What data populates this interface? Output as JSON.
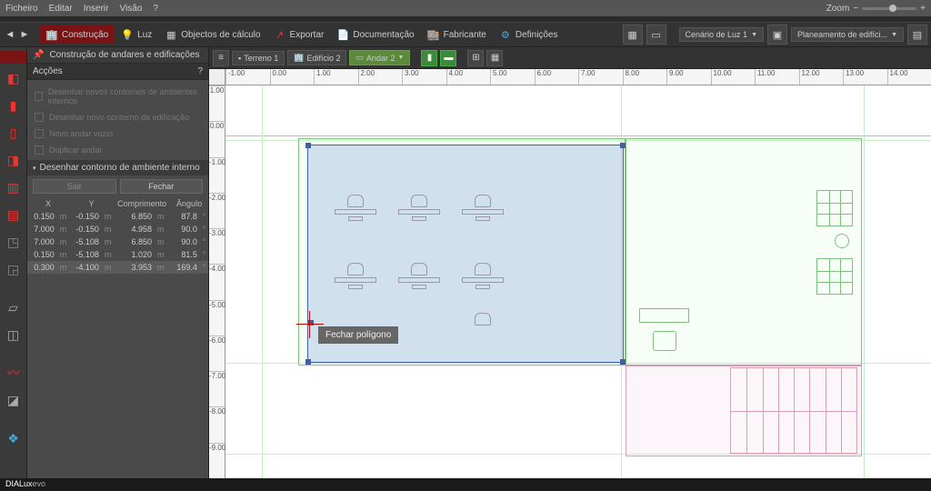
{
  "menu": {
    "ficheiro": "Ficheiro",
    "editar": "Editar",
    "inserir": "Inserir",
    "visao": "Visão",
    "help": "?",
    "zoom": "Zoom"
  },
  "toolbar": {
    "construcao": "Construção",
    "luz": "Luz",
    "objectos": "Objectos de cálculo",
    "exportar": "Exportar",
    "documentacao": "Documentação",
    "fabricante": "Fabricante",
    "definicoes": "Definições",
    "cenario": "Cenário de Luz 1",
    "planeamento": "Planeamento de edifíci..."
  },
  "viewbar": {
    "terreno": "Terreno 1",
    "edificio": "Edifício 2",
    "andar": "Andar 2"
  },
  "panel": {
    "title": "Construção de andares e edificações",
    "accoes": "Acções",
    "act1": "Desenhar novos contornos de ambientes internos",
    "act2": "Desenhar novo contorno da edificação",
    "act3": "Novo andar vazio",
    "act4": "Duplicar andar",
    "sect": "Desenhar contorno de ambiente interno",
    "sair": "Sair",
    "fechar": "Fechar",
    "th_x": "X",
    "th_y": "Y",
    "th_c": "Comprimento",
    "th_a": "Ângulo",
    "rows": [
      {
        "x": "0.150",
        "y": "-0.150",
        "c": "6.850",
        "a": "87.8"
      },
      {
        "x": "7.000",
        "y": "-0.150",
        "c": "4.958",
        "a": "90.0"
      },
      {
        "x": "7.000",
        "y": "-5.108",
        "c": "6.850",
        "a": "90.0"
      },
      {
        "x": "0.150",
        "y": "-5.108",
        "c": "1.020",
        "a": "81.5"
      },
      {
        "x": "0.300",
        "y": "-4.100",
        "c": "3.953",
        "a": "169.4"
      }
    ],
    "unit_m": "m",
    "unit_deg": "°"
  },
  "ruler_h": [
    "-1.00",
    "0.00",
    "1.00",
    "2.00",
    "3.00",
    "4.00",
    "5.00",
    "6.00",
    "7.00",
    "8.00",
    "9.00",
    "10.00",
    "11.00",
    "12.00",
    "13.00",
    "14.00"
  ],
  "ruler_v": [
    "1.00",
    "0.00",
    "-1.00",
    "-2.00",
    "-3.00",
    "-4.00",
    "-5.00",
    "-6.00",
    "-7.00",
    "-8.00",
    "-9.00"
  ],
  "tooltip": "Fechar polígono",
  "status": {
    "brand": "DIALux",
    "suffix": "evo"
  }
}
